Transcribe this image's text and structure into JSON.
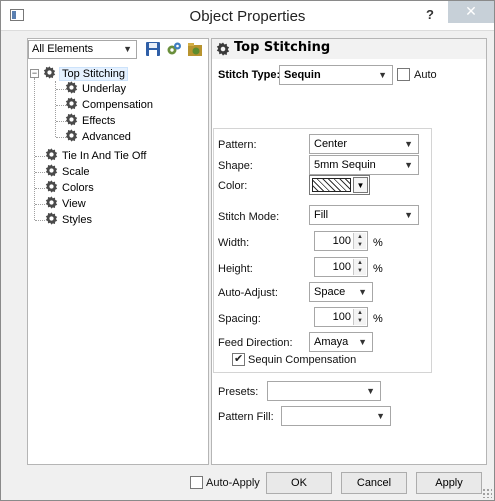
{
  "window": {
    "title": "Object Properties",
    "help_label": "?",
    "close_label": "✕"
  },
  "left_panel": {
    "filter_select": "All Elements",
    "toolbar_icons": [
      "save-icon",
      "elements-icon",
      "properties-icon"
    ],
    "tree": [
      {
        "label": "Top Stitching",
        "selected": true,
        "expanded": true,
        "level": 0
      },
      {
        "label": "Underlay",
        "level": 1
      },
      {
        "label": "Compensation",
        "level": 1
      },
      {
        "label": "Effects",
        "level": 1
      },
      {
        "label": "Advanced",
        "level": 1
      },
      {
        "label": "Tie In And Tie Off",
        "level": 0
      },
      {
        "label": "Scale",
        "level": 0
      },
      {
        "label": "Colors",
        "level": 0
      },
      {
        "label": "View",
        "level": 0
      },
      {
        "label": "Styles",
        "level": 0
      }
    ]
  },
  "right_panel": {
    "title": "Top Stitching",
    "stitch_type": {
      "label": "Stitch Type:",
      "value": "Sequin",
      "auto_label": "Auto",
      "auto_checked": false
    },
    "pattern": {
      "label": "Pattern:",
      "value": "Center"
    },
    "shape": {
      "label": "Shape:",
      "value": "5mm Sequin"
    },
    "color": {
      "label": "Color:"
    },
    "stitch_mode": {
      "label": "Stitch Mode:",
      "value": "Fill"
    },
    "width": {
      "label": "Width:",
      "value": "100",
      "unit": "%"
    },
    "height": {
      "label": "Height:",
      "value": "100",
      "unit": "%"
    },
    "auto_adjust": {
      "label": "Auto-Adjust:",
      "value": "Space"
    },
    "spacing": {
      "label": "Spacing:",
      "value": "100",
      "unit": "%"
    },
    "feed_direction": {
      "label": "Feed Direction:",
      "value": "Amaya"
    },
    "sequin_compensation": {
      "label": "Sequin Compensation",
      "checked": true
    },
    "presets": {
      "label": "Presets:",
      "value": ""
    },
    "pattern_fill": {
      "label": "Pattern Fill:",
      "value": ""
    }
  },
  "footer": {
    "auto_apply_label": "Auto-Apply",
    "auto_apply_checked": false,
    "ok_label": "OK",
    "cancel_label": "Cancel",
    "apply_label": "Apply"
  }
}
